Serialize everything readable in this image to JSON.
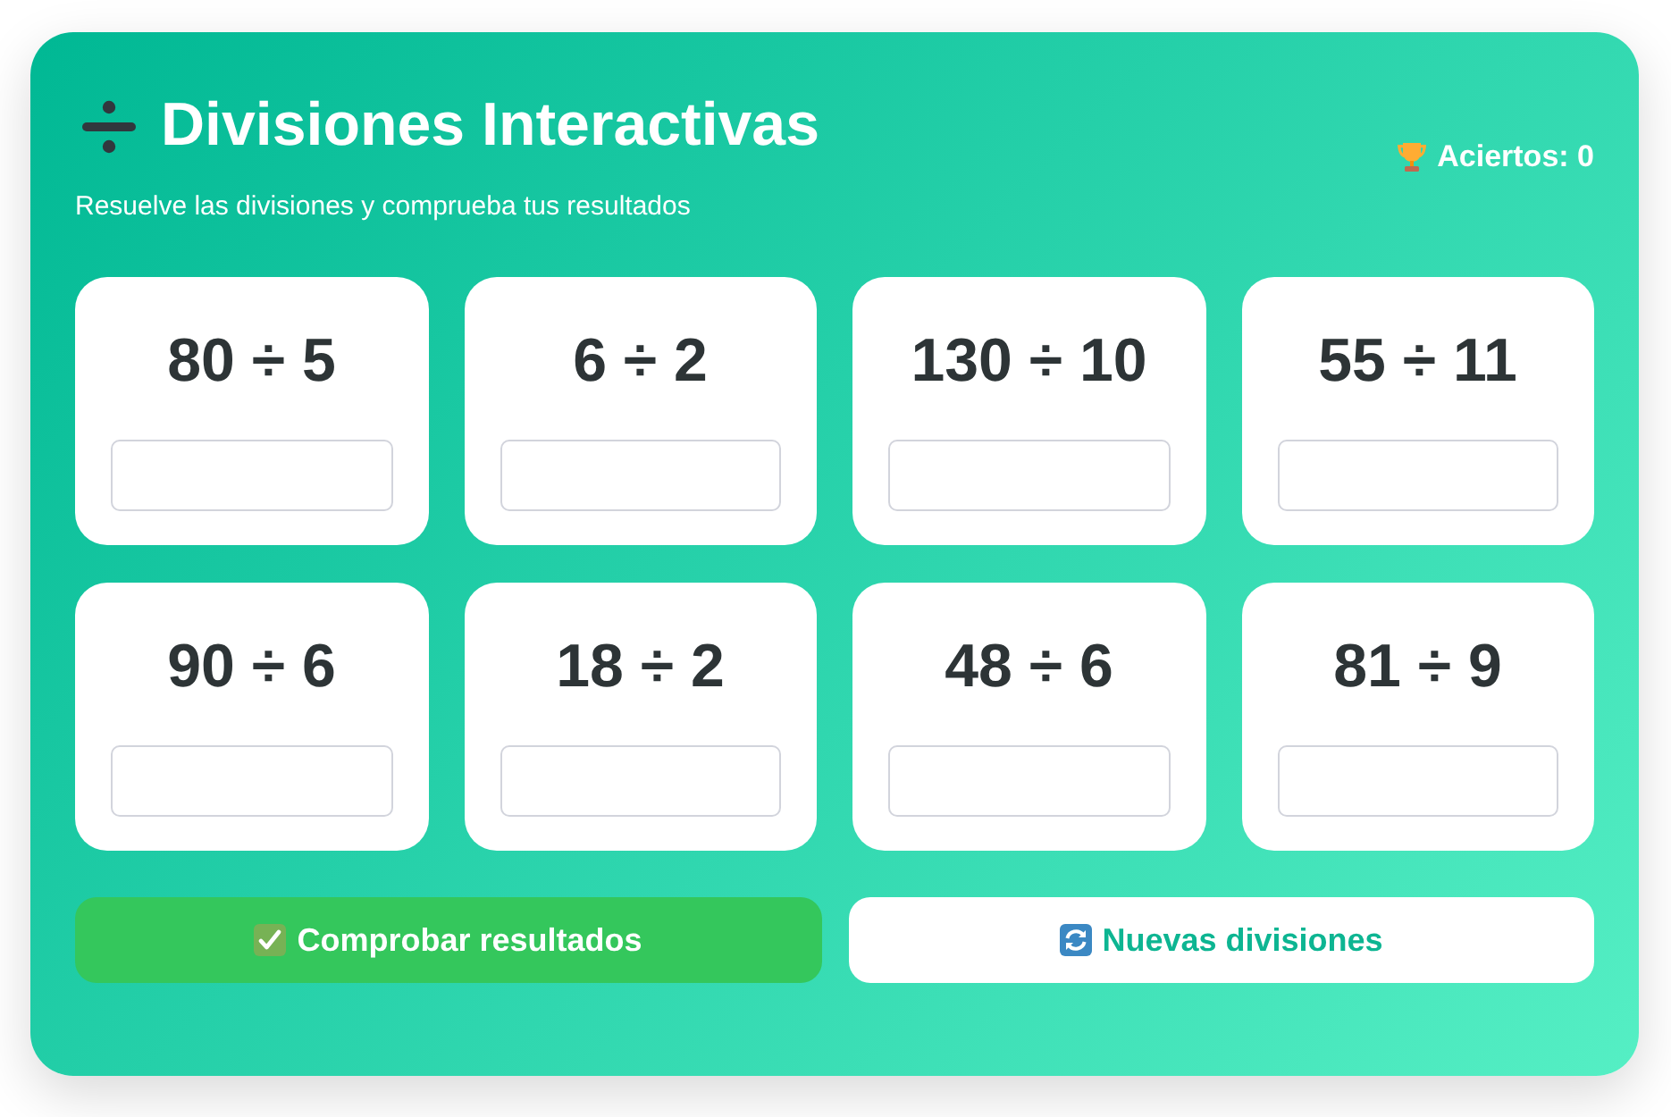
{
  "header": {
    "title": "Divisiones Interactivas",
    "subtitle": "Resuelve las divisiones y comprueba tus resultados",
    "score": "Aciertos: 0"
  },
  "problems": [
    {
      "expression": "80 ÷ 5"
    },
    {
      "expression": "6 ÷ 2"
    },
    {
      "expression": "130 ÷ 10"
    },
    {
      "expression": "55 ÷ 11"
    },
    {
      "expression": "90 ÷ 6"
    },
    {
      "expression": "18 ÷ 2"
    },
    {
      "expression": "48 ÷ 6"
    },
    {
      "expression": "81 ÷ 9"
    }
  ],
  "buttons": [
    {
      "label": "Comprobar resultados",
      "kind": "check"
    },
    {
      "label": "Nuevas divisiones",
      "kind": "new"
    }
  ]
}
